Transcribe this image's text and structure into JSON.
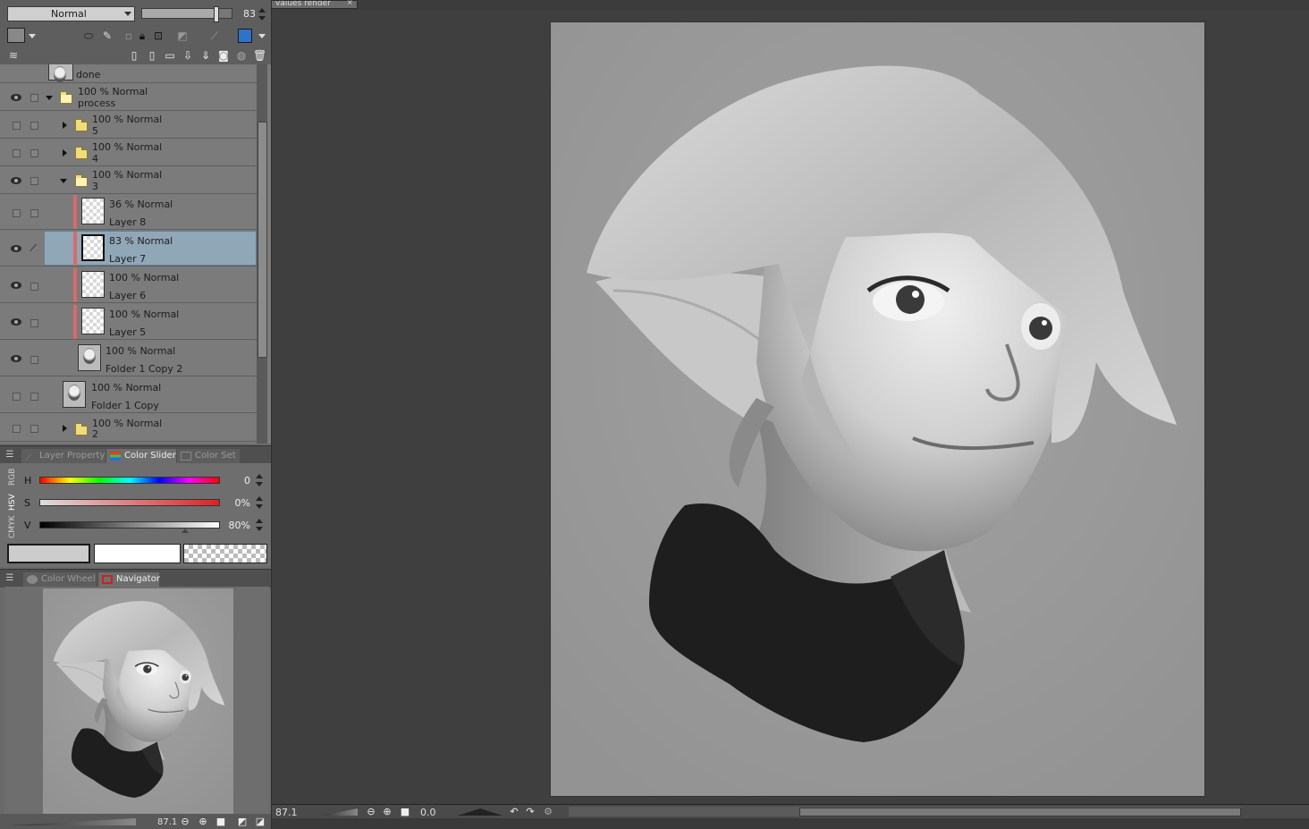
{
  "toolbar": {
    "blend_mode": "Normal",
    "opacity": "83",
    "opacity_fraction": 0.83
  },
  "layers": [
    {
      "opacity_mode": "",
      "name": "done"
    },
    {
      "opacity_mode": "100 % Normal",
      "name": "process"
    },
    {
      "opacity_mode": "100 % Normal",
      "name": "5"
    },
    {
      "opacity_mode": "100 % Normal",
      "name": "4"
    },
    {
      "opacity_mode": "100 % Normal",
      "name": "3"
    },
    {
      "opacity_mode": "36 % Normal",
      "name": "Layer 8"
    },
    {
      "opacity_mode": "83 % Normal",
      "name": "Layer 7"
    },
    {
      "opacity_mode": "100 % Normal",
      "name": "Layer 6"
    },
    {
      "opacity_mode": "100 % Normal",
      "name": "Layer 5"
    },
    {
      "opacity_mode": "100 % Normal",
      "name": "Folder 1 Copy 2"
    },
    {
      "opacity_mode": "100 % Normal",
      "name": "Folder 1 Copy"
    },
    {
      "opacity_mode": "100 % Normal",
      "name": "2"
    }
  ],
  "tabs_mid": {
    "layer_property": "Layer Property",
    "color_slider": "Color Slider",
    "color_set": "Color Set"
  },
  "color_slider": {
    "modes": {
      "rgb": "RGB",
      "hsv": "HSV",
      "cmyk": "CMYK"
    },
    "h_label": "H",
    "h_value": "0",
    "s_label": "S",
    "s_value": "0%",
    "v_label": "V",
    "v_value": "80%"
  },
  "tabs_bottom": {
    "color_wheel": "Color Wheel",
    "navigator": "Navigator"
  },
  "document": {
    "tab_title": "values render",
    "close_glyph": "×"
  },
  "statusbar": {
    "zoom": "87.1",
    "rotation": "0.0"
  },
  "navigator": {
    "zoom": "87.1"
  },
  "colors": {
    "panel": "#6a6a6a",
    "selected_layer": "#90a7b7",
    "layer_color_label": "#d96a6a",
    "canvas_bg": "#9a9a9a"
  }
}
